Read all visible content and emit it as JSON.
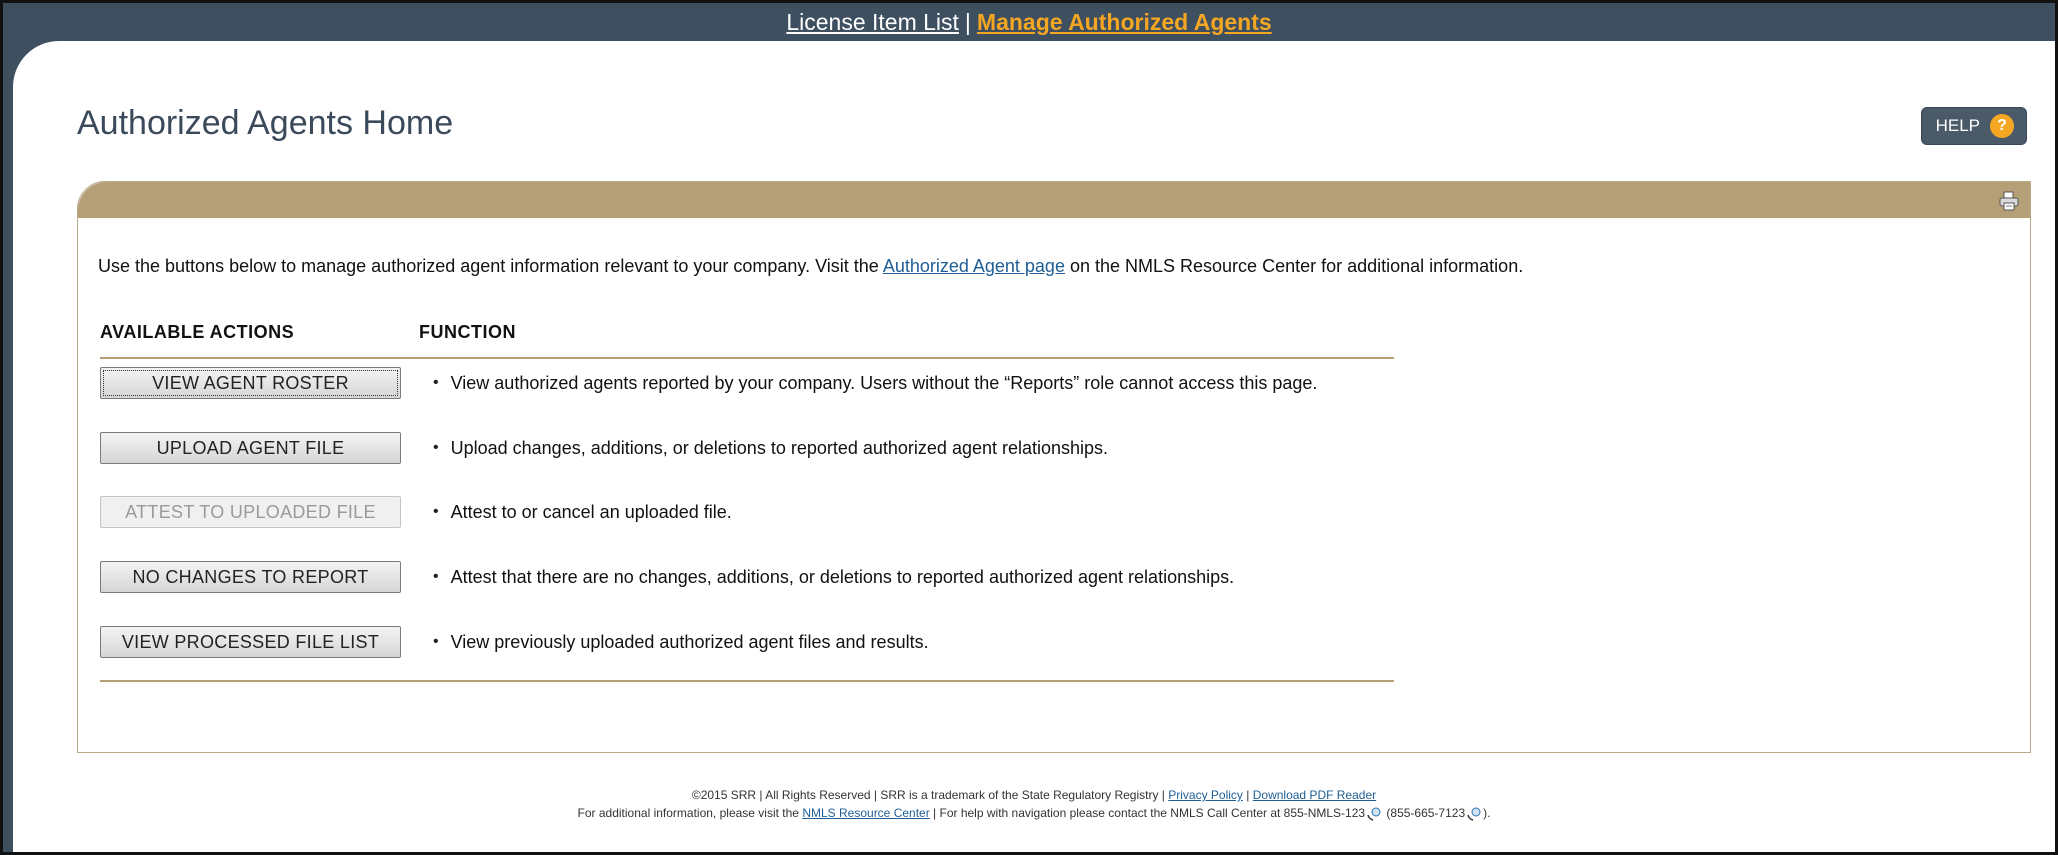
{
  "topnav": {
    "license_item_list": "License Item List",
    "separator": "|",
    "manage_authorized_agents": "Manage Authorized Agents"
  },
  "page": {
    "title": "Authorized Agents Home",
    "help_label": "HELP",
    "help_icon_glyph": "?"
  },
  "panel": {
    "intro_before": "Use the buttons below to manage authorized agent information relevant to your company. Visit the ",
    "intro_link": "Authorized Agent page",
    "intro_after": " on the NMLS Resource Center for additional information.",
    "col_actions": "AVAILABLE ACTIONS",
    "col_function": "FUNCTION",
    "actions": [
      {
        "label": "VIEW AGENT ROSTER",
        "description": "View authorized agents reported by your company. Users without the “Reports” role cannot access this page.",
        "enabled": true
      },
      {
        "label": "UPLOAD AGENT FILE",
        "description": "Upload changes, additions, or deletions to reported authorized agent relationships.",
        "enabled": true
      },
      {
        "label": "ATTEST TO UPLOADED FILE",
        "description": "Attest to or cancel an uploaded file.",
        "enabled": false
      },
      {
        "label": "NO CHANGES TO REPORT",
        "description": "Attest that there are no changes, additions, or deletions to reported authorized agent relationships.",
        "enabled": true
      },
      {
        "label": "VIEW PROCESSED FILE LIST",
        "description": "View previously uploaded authorized agent files and results.",
        "enabled": true
      }
    ],
    "bullet": "•"
  },
  "footer": {
    "line1_text": "©2015 SRR | All Rights Reserved | SRR is a trademark of the State Regulatory Registry | ",
    "privacy_policy": "Privacy Policy",
    "line1_sep": " | ",
    "download_pdf": "Download PDF Reader",
    "line2_before": "For additional information, please visit the ",
    "nmls_resource_center": "NMLS Resource Center",
    "line2_middle": " | For help with navigation please contact the NMLS Call Center at 855-NMLS-123",
    "line2_phone2": " (855-665-7123",
    "line2_end": ")."
  },
  "colors": {
    "header_bar": "#3e4f60",
    "accent_orange": "#f5a623",
    "panel_tan": "#b49f76",
    "link_blue": "#1f5e96"
  },
  "icons": {
    "help": "question-circle-icon",
    "print": "printer-icon",
    "phone": "phone-icon"
  }
}
